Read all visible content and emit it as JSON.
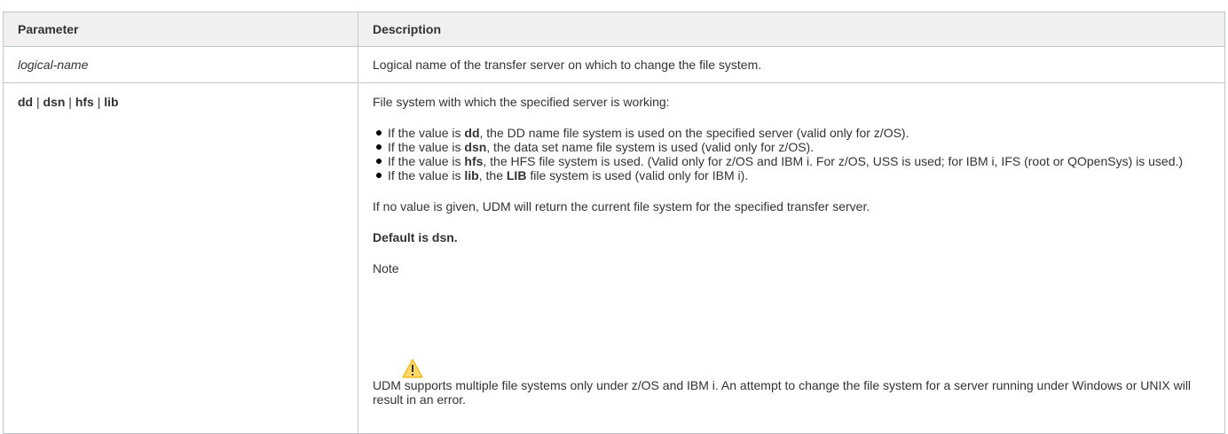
{
  "table": {
    "header": {
      "parameter": "Parameter",
      "description": "Description"
    },
    "row1": {
      "parameter": "logical-name",
      "description": "Logical name of the transfer server on which to change the file system."
    },
    "row2": {
      "parameter": {
        "opt1": "dd",
        "sep1": " | ",
        "opt2": "dsn",
        "sep2": " | ",
        "opt3": "hfs",
        "sep3": " | ",
        "opt4": "lib"
      },
      "intro": "File system with which the specified server is working:",
      "bullets": [
        {
          "pre": "If the value is ",
          "bold": "dd",
          "post": ", the DD name file system is used on the specified server (valid only for z/OS)."
        },
        {
          "pre": "If the value is ",
          "bold": "dsn",
          "post": ", the data set name file system is used (valid only for z/OS)."
        },
        {
          "pre": "If the value is ",
          "bold": "hfs",
          "post": ", the HFS file system is used. (Valid only for z/OS and IBM i. For z/OS, USS is used; for IBM i, IFS (root or QOpenSys) is used.)"
        },
        {
          "pre": "If the value is ",
          "bold": "lib",
          "mid": ", the ",
          "bold2": "LIB",
          "post": " file system is used (valid only for IBM i)."
        }
      ],
      "no_value_text": "If no value is given, UDM will return the current file system for the specified transfer server.",
      "default_text": "Default is dsn.",
      "note_label": "Note",
      "note_icon": "warning-icon",
      "note_text": "UDM supports multiple file systems only under z/OS and IBM i. An attempt to change the file system for a server running under Windows or UNIX will result in an error."
    }
  },
  "colors": {
    "header_bg": "#f0f0f0",
    "border": "#c1c7d0",
    "text": "#333333",
    "warning_fill": "#ffd351",
    "warning_stroke": "#f5b300"
  }
}
